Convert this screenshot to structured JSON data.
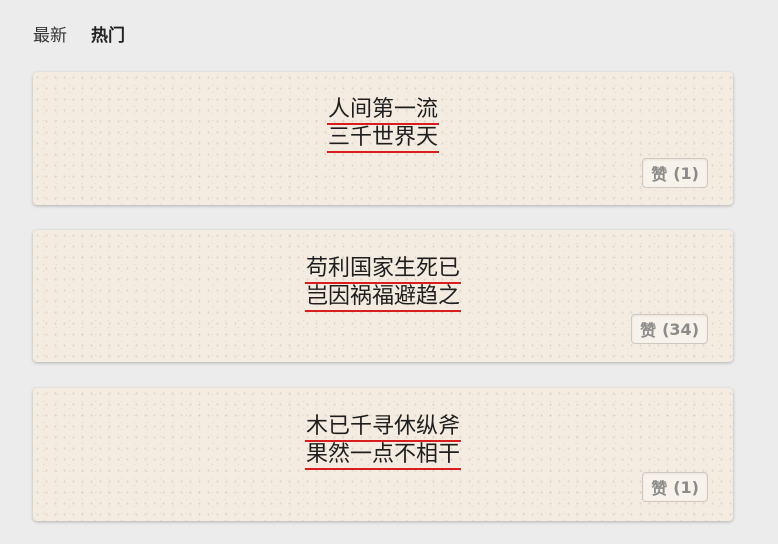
{
  "tabs": [
    {
      "label": "最新",
      "active": false
    },
    {
      "label": "热门",
      "active": true
    }
  ],
  "cards": [
    {
      "lines": [
        "人间第一流",
        "三千世界天"
      ],
      "like": {
        "label": "赞",
        "count": "(1)"
      }
    },
    {
      "lines": [
        "苟利国家生死已",
        "岂因祸福避趋之"
      ],
      "like": {
        "label": "赞",
        "count": "(34)"
      }
    },
    {
      "lines": [
        "木已千寻休纵斧",
        "果然一点不相干"
      ],
      "like": {
        "label": "赞",
        "count": "(1)"
      }
    }
  ],
  "colors": {
    "background": "#ececec",
    "card": "#f4ece0",
    "underline": "#d81e1e",
    "like_text": "#8b8b8b"
  }
}
